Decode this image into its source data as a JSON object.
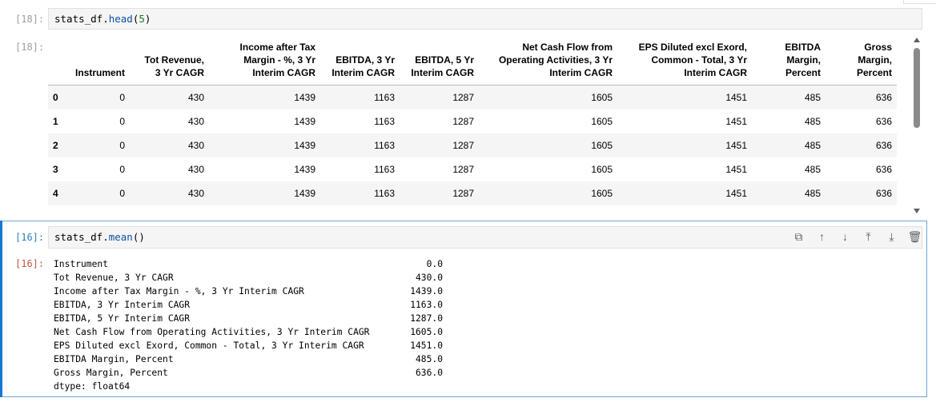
{
  "cells": [
    {
      "prompt_in": "[18]:",
      "prompt_out": "[18]:",
      "code": {
        "obj": "stats_df.",
        "fn": "head",
        "open": "(",
        "arg": "5",
        "close": ")"
      },
      "table": {
        "columns": [
          {
            "lines": [
              "Instrument"
            ]
          },
          {
            "lines": [
              "Tot Revenue,",
              "3 Yr CAGR"
            ]
          },
          {
            "lines": [
              "Income after Tax",
              "Margin - %, 3 Yr",
              "Interim CAGR"
            ]
          },
          {
            "lines": [
              "EBITDA, 3 Yr",
              "Interim CAGR"
            ]
          },
          {
            "lines": [
              "EBITDA, 5 Yr",
              "Interim CAGR"
            ]
          },
          {
            "lines": [
              "Net Cash Flow from",
              "Operating Activities, 3 Yr",
              "Interim CAGR"
            ]
          },
          {
            "lines": [
              "EPS Diluted excl Exord,",
              "Common - Total, 3 Yr",
              "Interim CAGR"
            ]
          },
          {
            "lines": [
              "EBITDA",
              "Margin,",
              "Percent"
            ]
          },
          {
            "lines": [
              "Gross",
              "Margin,",
              "Percent"
            ]
          }
        ],
        "rows": [
          {
            "index": "0",
            "values": [
              "0",
              "430",
              "1439",
              "1163",
              "1287",
              "1605",
              "1451",
              "485",
              "636"
            ]
          },
          {
            "index": "1",
            "values": [
              "0",
              "430",
              "1439",
              "1163",
              "1287",
              "1605",
              "1451",
              "485",
              "636"
            ]
          },
          {
            "index": "2",
            "values": [
              "0",
              "430",
              "1439",
              "1163",
              "1287",
              "1605",
              "1451",
              "485",
              "636"
            ]
          },
          {
            "index": "3",
            "values": [
              "0",
              "430",
              "1439",
              "1163",
              "1287",
              "1605",
              "1451",
              "485",
              "636"
            ]
          },
          {
            "index": "4",
            "values": [
              "0",
              "430",
              "1439",
              "1163",
              "1287",
              "1605",
              "1451",
              "485",
              "636"
            ]
          }
        ]
      }
    },
    {
      "prompt_in": "[16]:",
      "prompt_out": "[16]:",
      "code": {
        "obj": "stats_df.",
        "fn": "mean",
        "open": "()",
        "arg": "",
        "close": ""
      },
      "series": [
        {
          "key": "Instrument",
          "value": "0.0"
        },
        {
          "key": "Tot Revenue, 3 Yr CAGR",
          "value": "430.0"
        },
        {
          "key": "Income after Tax Margin - %, 3 Yr Interim CAGR",
          "value": "1439.0"
        },
        {
          "key": "EBITDA, 3 Yr Interim CAGR",
          "value": "1163.0"
        },
        {
          "key": "EBITDA, 5 Yr Interim CAGR",
          "value": "1287.0"
        },
        {
          "key": "Net Cash Flow from Operating Activities, 3 Yr Interim CAGR",
          "value": "1605.0"
        },
        {
          "key": "EPS Diluted excl Exord, Common - Total, 3 Yr Interim CAGR",
          "value": "1451.0"
        },
        {
          "key": "EBITDA Margin, Percent",
          "value": "485.0"
        },
        {
          "key": "Gross Margin, Percent",
          "value": "636.0"
        }
      ],
      "dtype": "dtype: float64",
      "toolbar": [
        {
          "name": "duplicate-cell-button",
          "icon": "copy-icon",
          "glyph": "⧉"
        },
        {
          "name": "move-up-button",
          "icon": "arrow-up-icon",
          "glyph": "↑"
        },
        {
          "name": "move-down-button",
          "icon": "arrow-down-icon",
          "glyph": "↓"
        },
        {
          "name": "insert-above-button",
          "icon": "insert-above-icon",
          "glyph": "⤒"
        },
        {
          "name": "insert-below-button",
          "icon": "insert-below-icon",
          "glyph": "⤓"
        },
        {
          "name": "delete-cell-button",
          "icon": "trash-icon",
          "glyph": "🗑"
        }
      ]
    }
  ],
  "colors": {
    "accent": "#1976d2",
    "prompt_in": "#307fc1",
    "prompt_out": "#bf5b3d"
  }
}
